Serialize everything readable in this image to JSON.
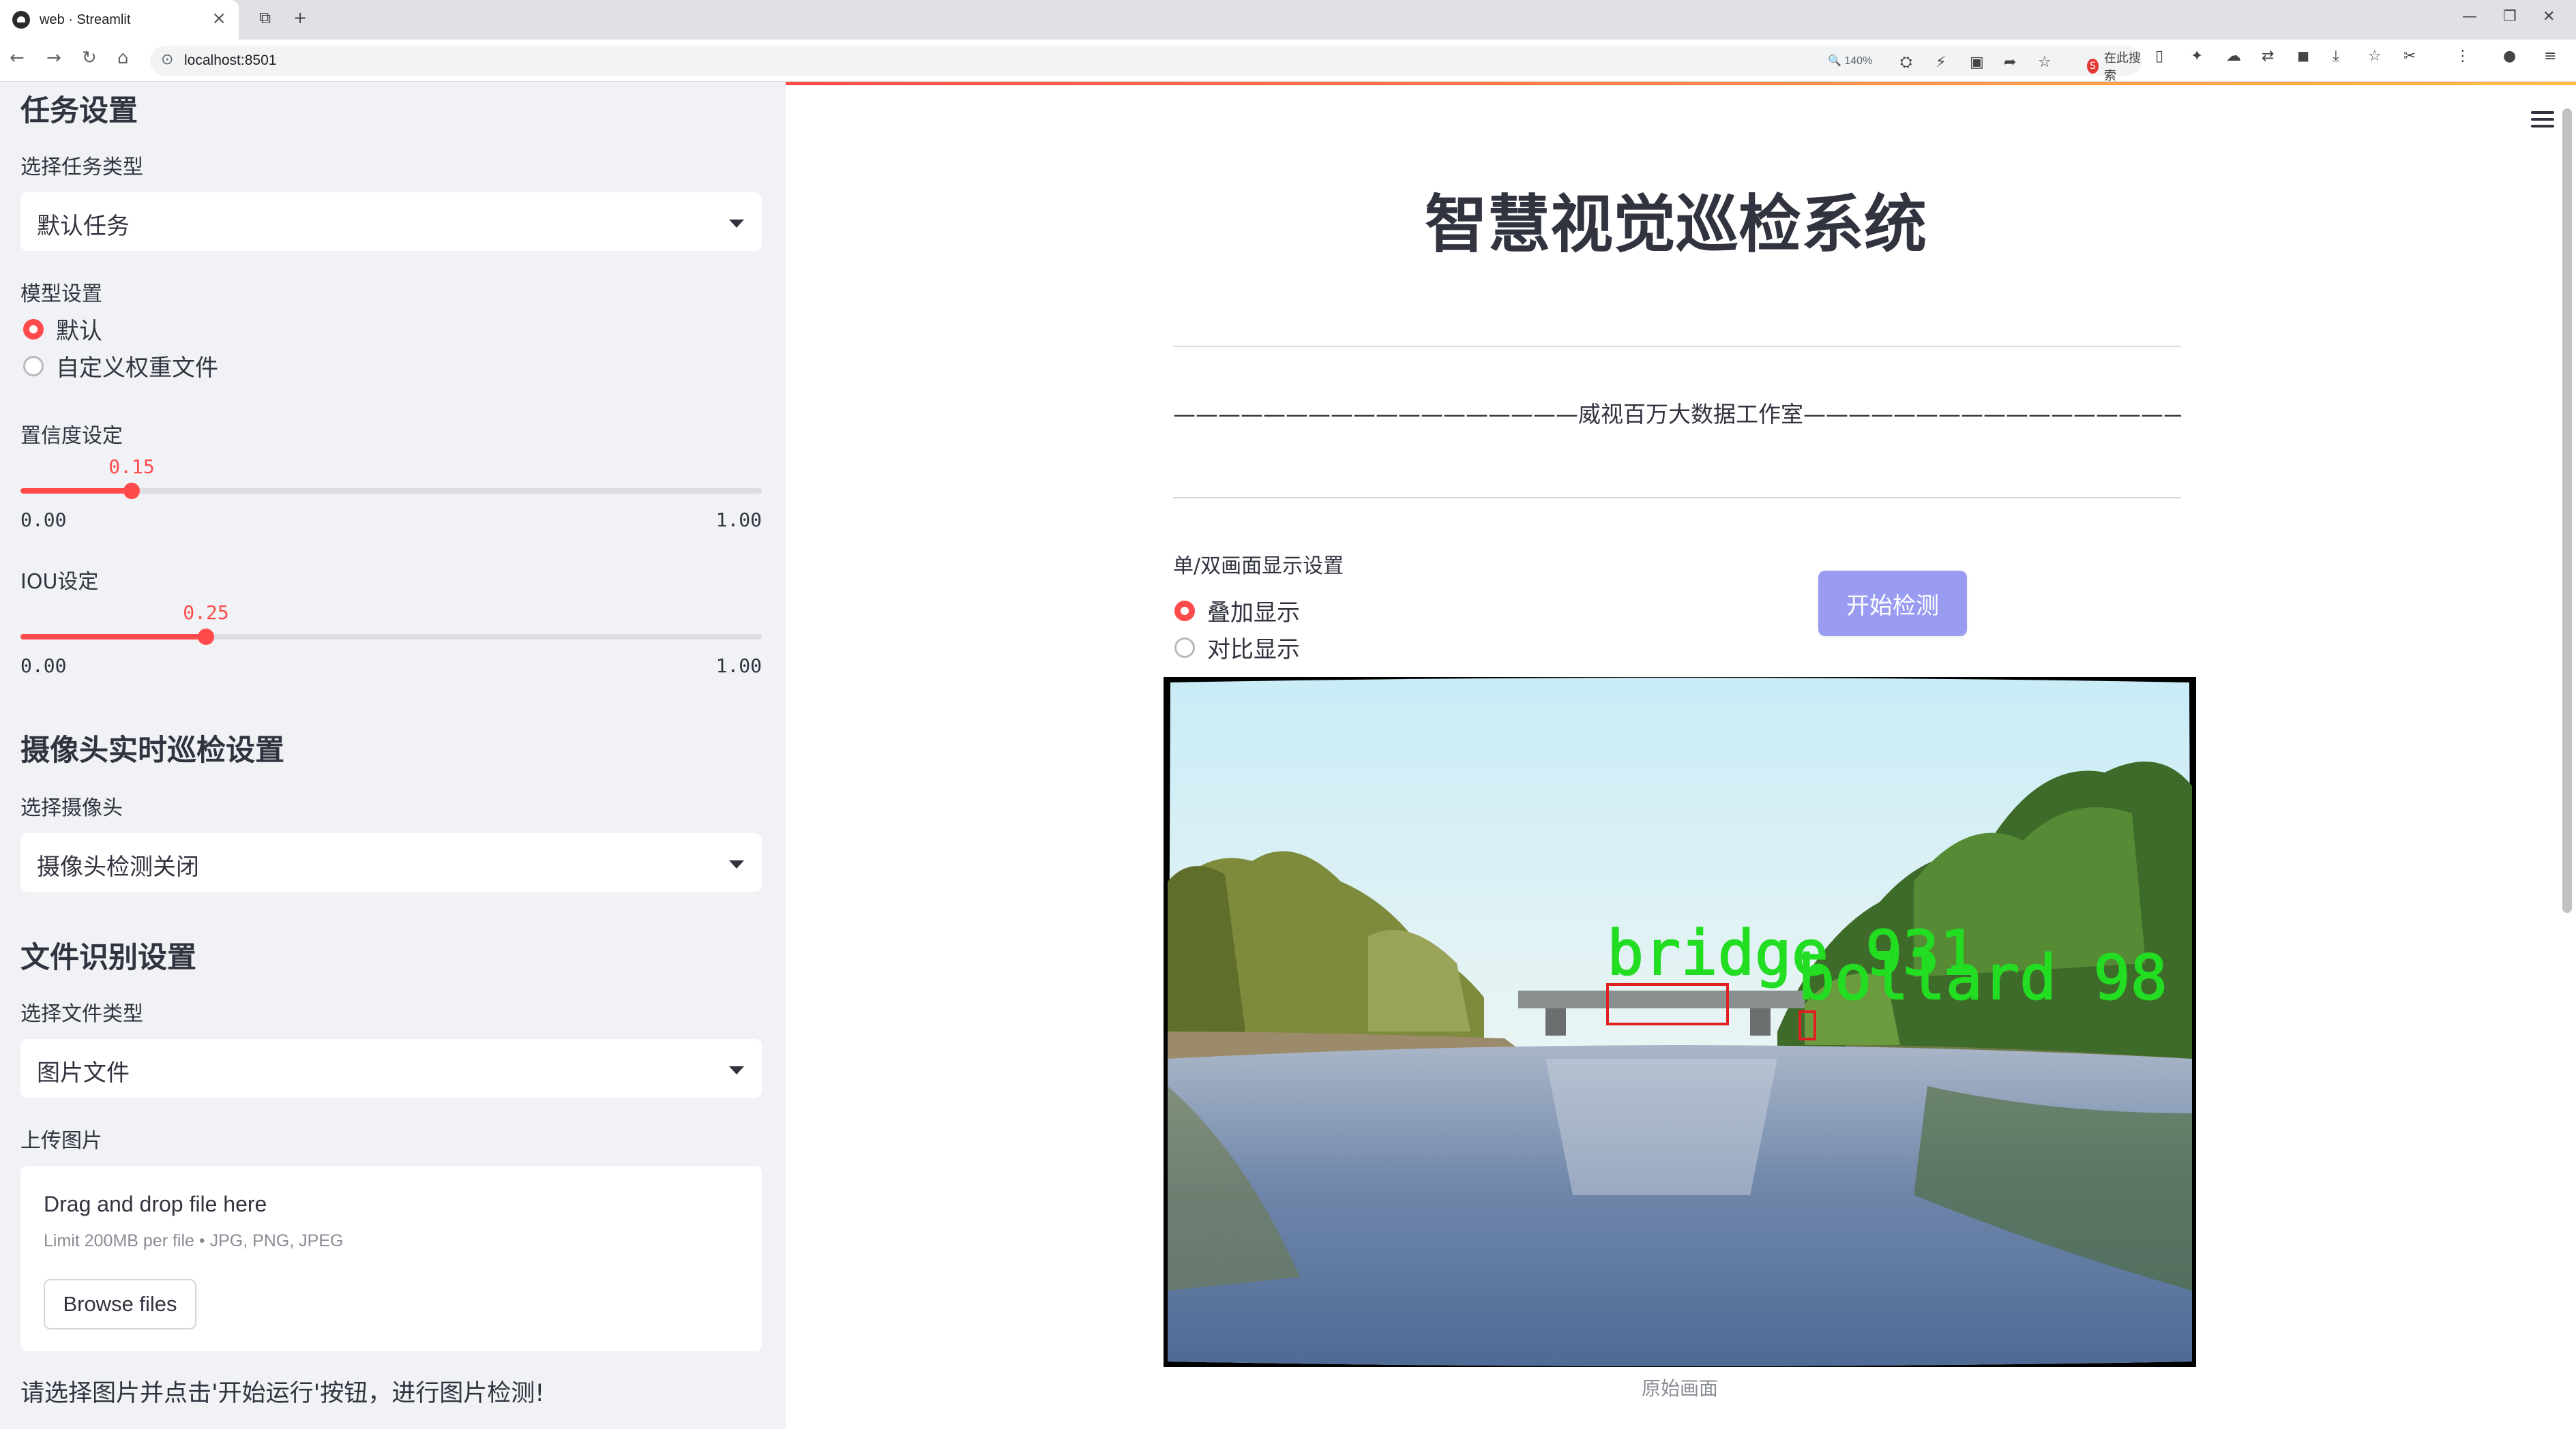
{
  "browser": {
    "tab_title": "web · Streamlit",
    "tab_close": "×",
    "new_tab": "+",
    "url": "localhost:8501",
    "zoom": "140%",
    "search_label": "在此搜索",
    "search_engine_badge": "S"
  },
  "sidebar": {
    "task_section_title": "任务设置",
    "task_type_label": "选择任务类型",
    "task_type_value": "默认任务",
    "model_label": "模型设置",
    "model_options": [
      "默认",
      "自定义权重文件"
    ],
    "model_selected": "默认",
    "confidence_label": "置信度设定",
    "confidence": {
      "value": 0.15,
      "value_text": "0.15",
      "min_text": "0.00",
      "max_text": "1.00"
    },
    "iou_label": "IOU设定",
    "iou": {
      "value": 0.25,
      "value_text": "0.25",
      "min_text": "0.00",
      "max_text": "1.00"
    },
    "camera_section_title": "摄像头实时巡检设置",
    "camera_label": "选择摄像头",
    "camera_value": "摄像头检测关闭",
    "file_section_title": "文件识别设置",
    "file_type_label": "选择文件类型",
    "file_type_value": "图片文件",
    "upload_label": "上传图片",
    "upload_title": "Drag and drop file here",
    "upload_limit": "Limit 200MB per file • JPG, PNG, JPEG",
    "browse_button": "Browse files",
    "note": "请选择图片并点击'开始运行'按钮，进行图片检测!"
  },
  "main": {
    "title": "智慧视觉巡检系统",
    "subtitle": "——————————————————威视百万大数据工作室———————————————————",
    "display_label": "单/双画面显示设置",
    "display_options": [
      "叠加显示",
      "对比显示"
    ],
    "display_selected": "叠加显示",
    "start_button": "开始检测",
    "image_caption": "原始画面",
    "detections": [
      {
        "label": "bridge",
        "score": "931"
      },
      {
        "label": "bollard",
        "score": "98"
      }
    ],
    "detection_label_color": "#22dd22",
    "detection_box_color": "#e02020"
  },
  "colors": {
    "accent": "#ff4b4b",
    "primary_button": "#9a9cf2",
    "sidebar_bg": "#f0f2f6"
  }
}
